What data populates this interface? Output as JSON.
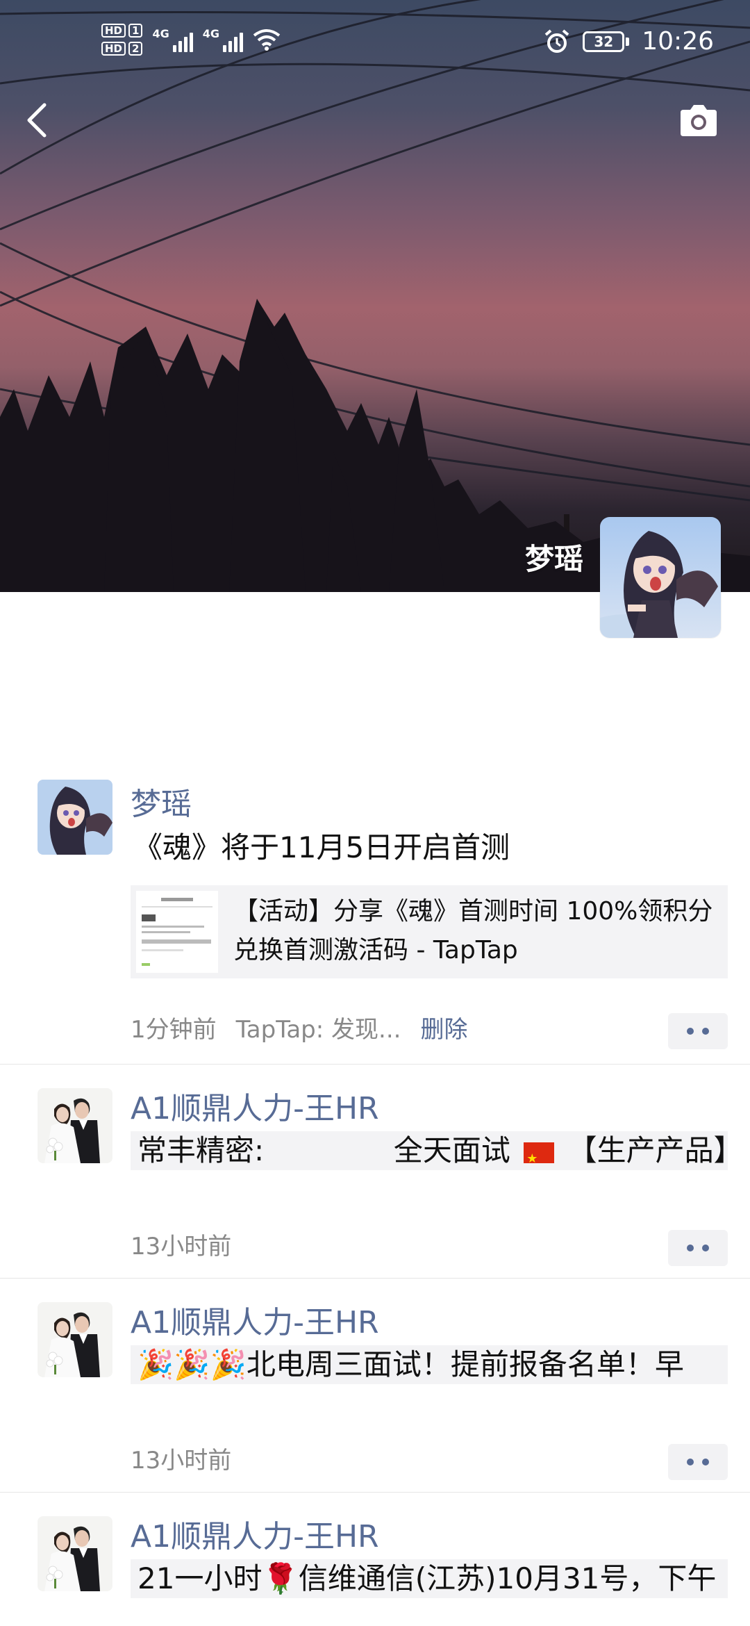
{
  "status_bar": {
    "hd1": "HD",
    "hd1_sim": "1",
    "hd2": "HD",
    "hd2_sim": "2",
    "net1": "4G",
    "net2": "4G",
    "battery": "32",
    "time": "10:26"
  },
  "profile": {
    "name": "梦瑶"
  },
  "posts": [
    {
      "author": "梦瑶",
      "text": "《魂》将于11月5日开启首测",
      "link_title": "【活动】分享《魂》首测时间 100%领积分兑换首测激活码 - TapTap",
      "time": "1分钟前",
      "source": "TapTap: 发现...",
      "delete_label": "删除"
    },
    {
      "author": "A1顺鼎人力-王HR",
      "text_a": "常丰精密:",
      "text_b": "全天面试",
      "text_c": "【生产产品】",
      "time": "13小时前"
    },
    {
      "author": "A1顺鼎人力-王HR",
      "text_emoji": "🎉🎉🎉",
      "text": "北电周三面试！提前报备名单！早",
      "time": "13小时前"
    },
    {
      "author": "A1顺鼎人力-王HR",
      "text_a": "21一小时",
      "text_emoji": "🌹",
      "text_b": "信维通信(江苏)10月31号，下午",
      "time": ""
    }
  ]
}
